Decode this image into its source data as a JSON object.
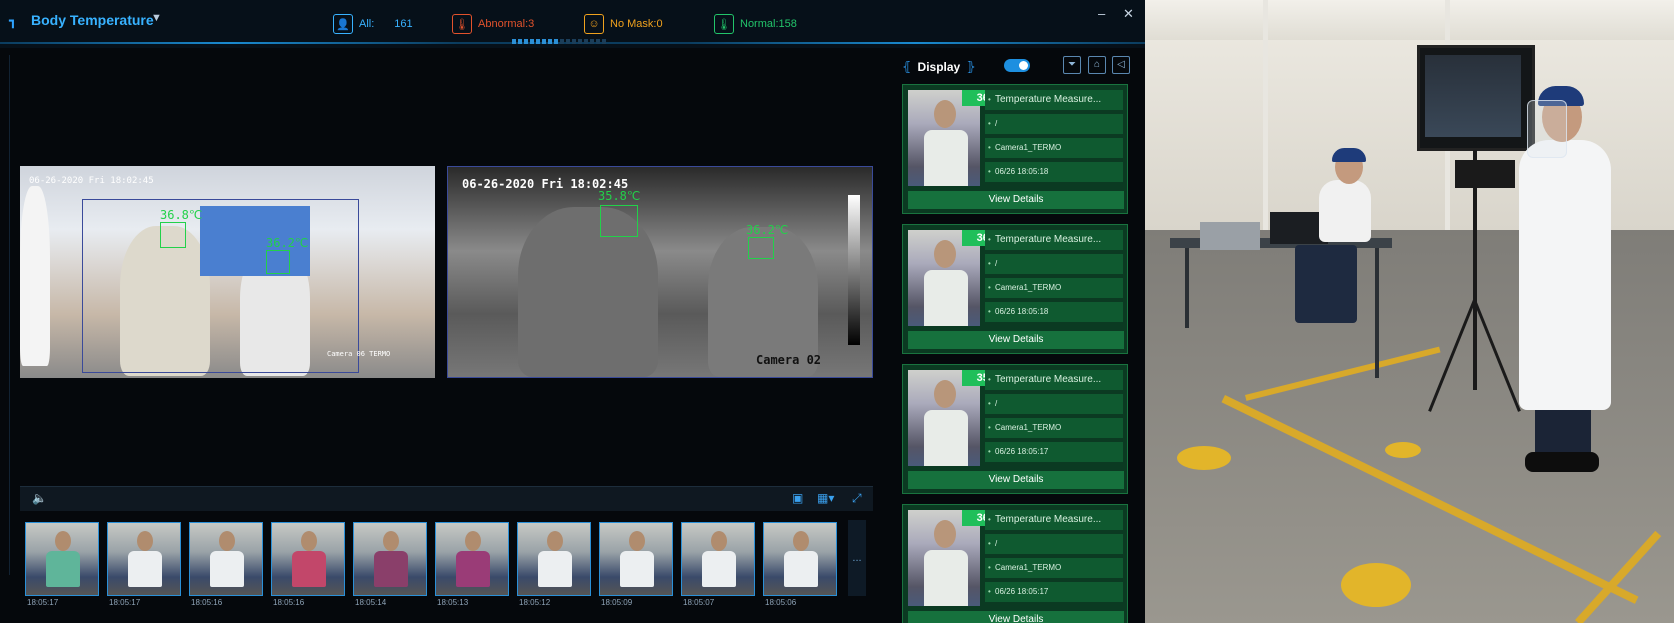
{
  "header": {
    "title": "Body Temperature",
    "stats": {
      "all_label": "All:",
      "all_value": "161",
      "abnormal": "Abnormal:3",
      "no_mask": "No Mask:0",
      "normal": "Normal:158"
    },
    "minimize": "–",
    "close": "✕"
  },
  "live": {
    "cam1_timestamp": "06-26-2020 Fri 18:02:45",
    "cam1_temp_a": "36.8℃",
    "cam1_temp_b": "36.2℃",
    "cam1_name": "Camera 06 TERMO",
    "cam2_timestamp": "06-26-2020 Fri 18:02:45",
    "cam2_temp_a": "35.8℃",
    "cam2_temp_b": "36.2℃",
    "cam2_name": "Camera 02"
  },
  "thumbnails": [
    {
      "time": "18:05:17",
      "shirt": "#5fb59a"
    },
    {
      "time": "18:05:17",
      "shirt": "#eceff1"
    },
    {
      "time": "18:05:16",
      "shirt": "#eceff1"
    },
    {
      "time": "18:05:16",
      "shirt": "#c2476a"
    },
    {
      "time": "18:05:14",
      "shirt": "#8a3f6a"
    },
    {
      "time": "18:05:13",
      "shirt": "#9a3c77"
    },
    {
      "time": "18:05:12",
      "shirt": "#eceff1"
    },
    {
      "time": "18:05:09",
      "shirt": "#eceff1"
    },
    {
      "time": "18:05:07",
      "shirt": "#eceff1"
    },
    {
      "time": "18:05:06",
      "shirt": "#eceff1"
    }
  ],
  "thumbs_more": "...",
  "panel": {
    "display_label": "Display",
    "toggle_on": true,
    "cards": [
      {
        "temp": "36.0 °C",
        "type": "Temperature Measure...",
        "value": "/",
        "camera": "Camera1_TERMO",
        "time": "06/26 18:05:18",
        "view": "View Details"
      },
      {
        "temp": "36.3 °C",
        "type": "Temperature Measure...",
        "value": "/",
        "camera": "Camera1_TERMO",
        "time": "06/26 18:05:18",
        "view": "View Details"
      },
      {
        "temp": "35.2 °C",
        "type": "Temperature Measure...",
        "value": "/",
        "camera": "Camera1_TERMO",
        "time": "06/26 18:05:17",
        "view": "View Details"
      },
      {
        "temp": "36.0 °C",
        "type": "Temperature Measure...",
        "value": "/",
        "camera": "Camera1_TERMO",
        "time": "06/26 18:05:17",
        "view": "View Details"
      }
    ]
  },
  "colors": {
    "accent": "#38b2ff",
    "abnormal": "#e2522c",
    "no_mask": "#f0a21e",
    "normal": "#22c46a",
    "card_bg": "#0b3a22"
  }
}
